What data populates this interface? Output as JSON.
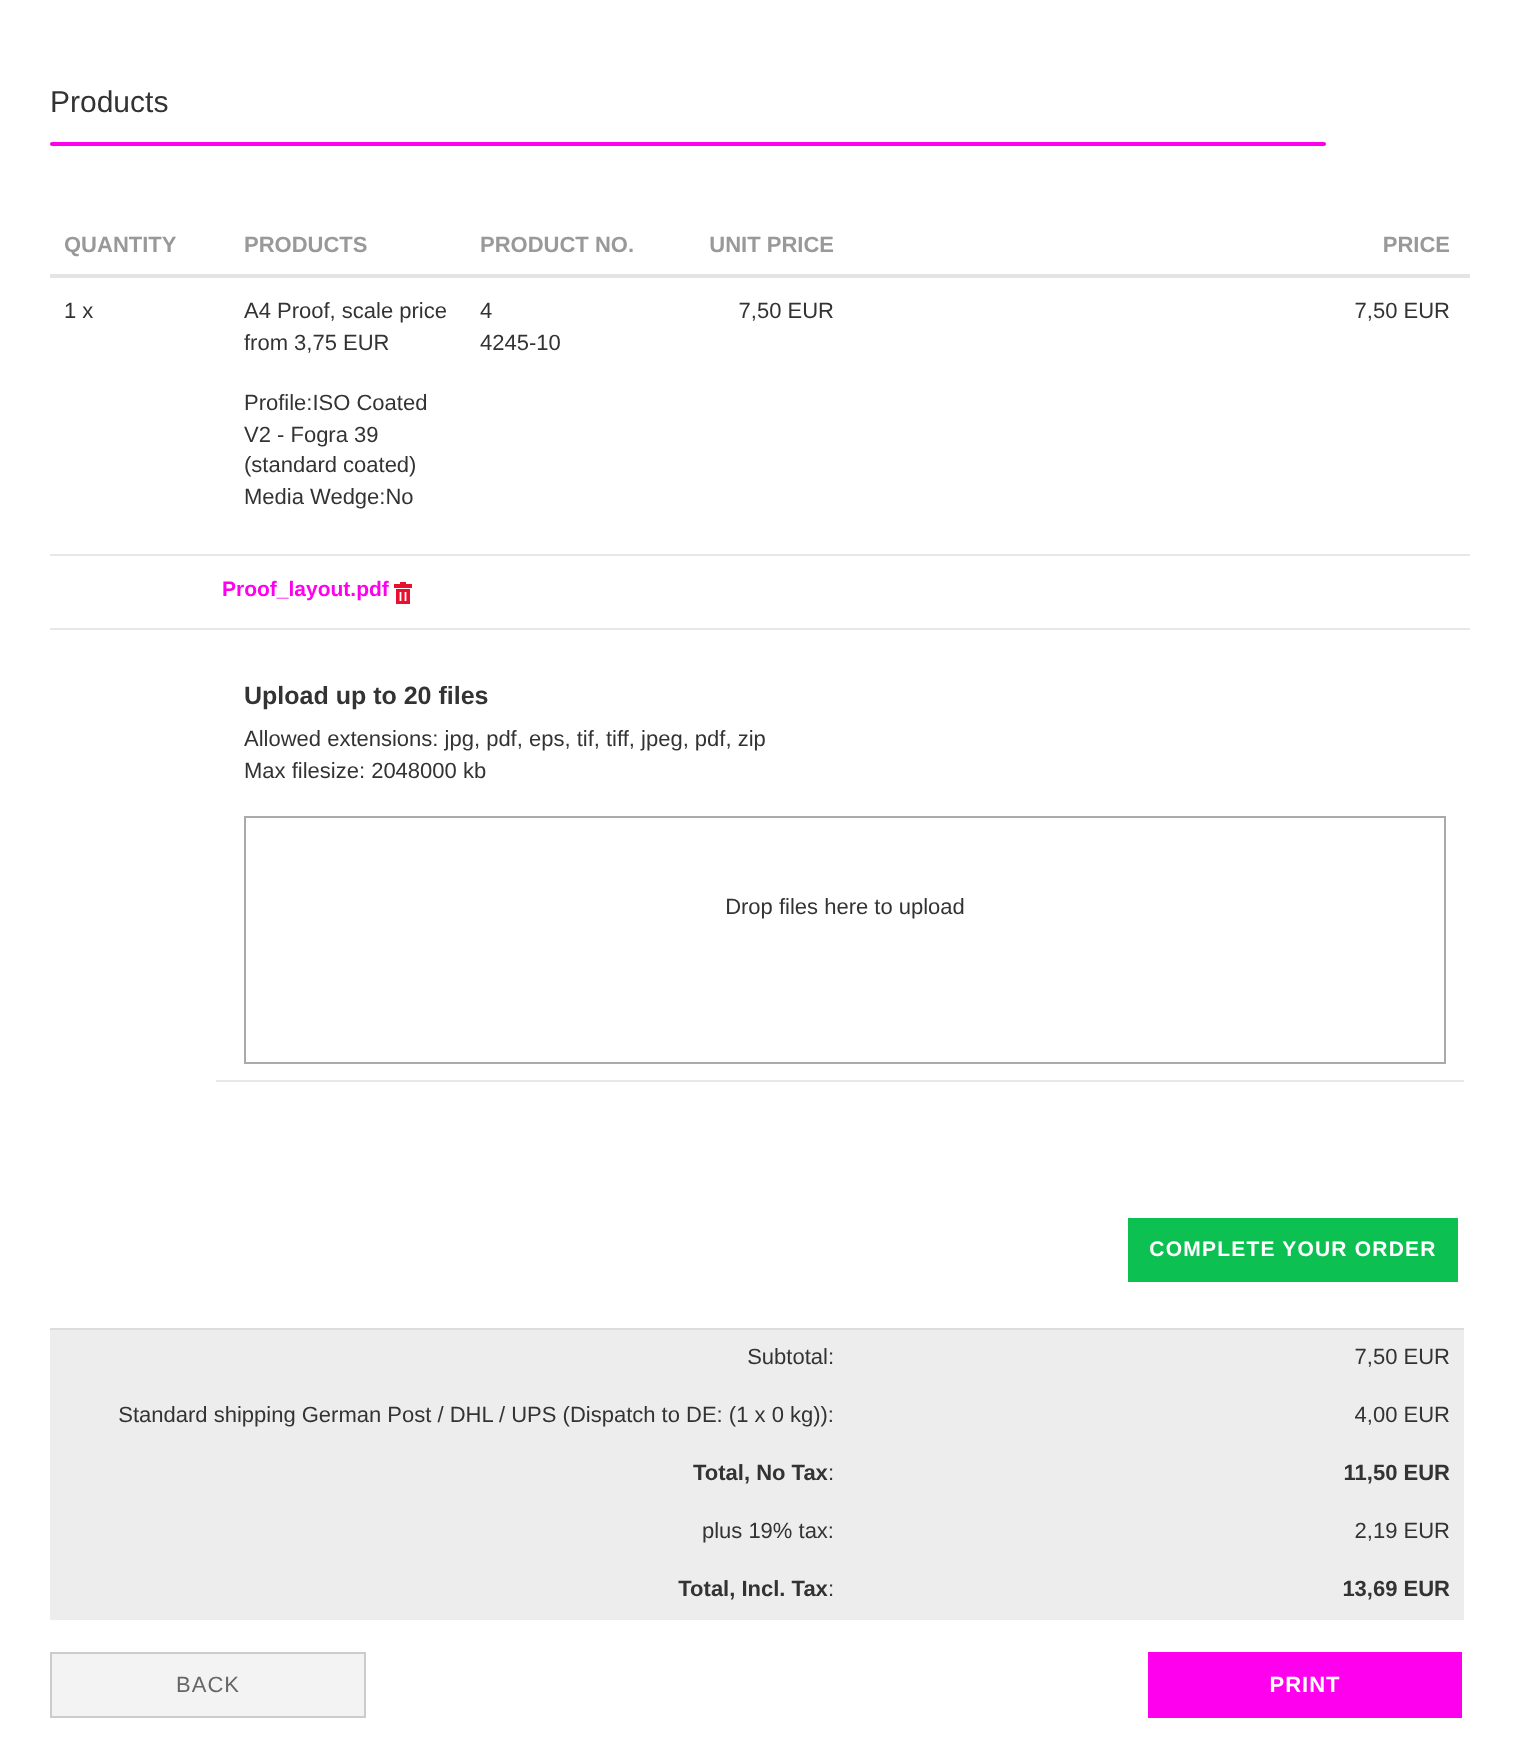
{
  "section": {
    "title": "Products"
  },
  "table": {
    "columns": [
      "QUANTITY",
      "PRODUCTS",
      "PRODUCT NO.",
      "UNIT PRICE",
      "PRICE"
    ],
    "rows": [
      {
        "quantity": "1 x",
        "product": {
          "name": "A4 Proof, scale price from 3,75 EUR",
          "options": [
            "Profile:ISO Coated V2 - Fogra 39 (standard coated)",
            "Media Wedge:No"
          ]
        },
        "product_no": [
          "4",
          "4245-10"
        ],
        "unit_price": "7,50 EUR",
        "price": "7,50 EUR"
      }
    ]
  },
  "attachments": [
    {
      "file_name": "Proof_layout.pdf"
    }
  ],
  "upload": {
    "title": "Upload up to 20 files",
    "notes": [
      "Allowed extensions: jpg, pdf, eps, tif, tiff, jpeg, pdf, zip",
      "Max filesize: 2048000 kb"
    ],
    "dropzone": "Drop files here to upload"
  },
  "complete_button": "COMPLETE YOUR ORDER",
  "totals": [
    {
      "label": "Subtotal:",
      "value": "7,50 EUR",
      "bold": false
    },
    {
      "label": "Standard shipping German Post / DHL / UPS (Dispatch to DE: (1 x 0 kg)):",
      "value": "4,00 EUR",
      "bold": false
    },
    {
      "label": "**Total, No Tax**:",
      "value": "11,50 EUR",
      "bold": true
    },
    {
      "label": "plus 19% tax:",
      "value": "2,19 EUR",
      "bold": false
    },
    {
      "label": "**Total, Incl. Tax**:",
      "value": "13,69 EUR",
      "bold": true
    }
  ],
  "buttons": [
    {
      "label": "BACK",
      "kind": "secondary"
    },
    {
      "label": "PRINT",
      "kind": "primary"
    }
  ]
}
